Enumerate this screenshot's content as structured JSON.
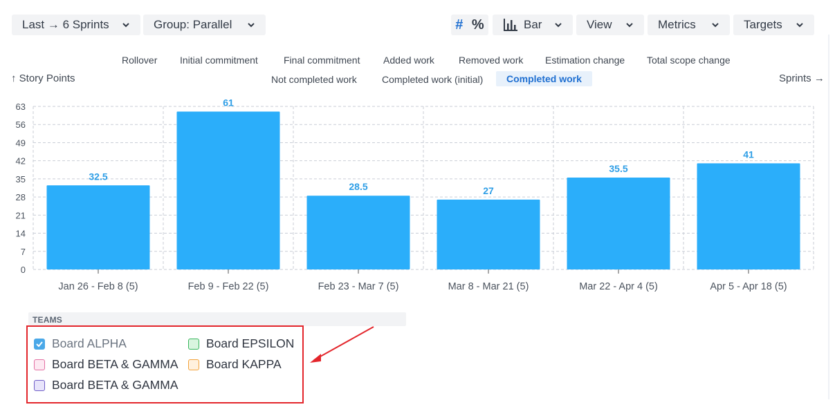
{
  "toolbar": {
    "period_label": "Last → 6 Sprints",
    "group_label": "Group: Parallel",
    "count_toggle": "#",
    "percent_toggle": "%",
    "chart_type_label": "Bar",
    "view_label": "View",
    "metrics_label": "Metrics",
    "targets_label": "Targets"
  },
  "metric_tabs_row1": [
    "Rollover",
    "Initial commitment",
    "Final commitment",
    "Added work",
    "Removed work",
    "Estimation change",
    "Total scope change"
  ],
  "metric_tabs_row2": [
    "Not completed work",
    "Completed work (initial)",
    "Completed work"
  ],
  "active_metric": "Completed work",
  "y_axis_title": "↑ Story Points",
  "x_axis_title": "Sprints →",
  "chart_data": {
    "type": "bar",
    "categories": [
      "Jan 26 - Feb 8 (5)",
      "Feb 9 - Feb 22 (5)",
      "Feb 23 - Mar 7 (5)",
      "Mar 8 - Mar 21 (5)",
      "Mar 22 - Apr 4 (5)",
      "Apr 5 - Apr 18 (5)"
    ],
    "values": [
      32.5,
      61,
      28.5,
      27,
      35.5,
      41
    ],
    "data_labels": [
      "32.5",
      "61",
      "28.5",
      "27",
      "35.5",
      "41"
    ],
    "yticks": [
      0,
      7,
      14,
      21,
      28,
      35,
      42,
      49,
      56,
      63
    ],
    "ylim": [
      0,
      63
    ],
    "grid": true,
    "bar_color": "#2baefa",
    "label_color": "#2e9ee6"
  },
  "teams": {
    "header": "TEAMS",
    "items": [
      {
        "label": "Board ALPHA",
        "checked": true,
        "color": "#4aa8e8",
        "fill": "#4aa8e8"
      },
      {
        "label": "Board EPSILON",
        "checked": false,
        "color": "#37b55c",
        "fill": "#d9f5df"
      },
      {
        "label": "Board BETA & GAMMA",
        "checked": false,
        "color": "#e36fa3",
        "fill": "#fde9f2"
      },
      {
        "label": "Board KAPPA",
        "checked": false,
        "color": "#f2a23b",
        "fill": "#fff1de"
      },
      {
        "label": "Board BETA & GAMMA",
        "checked": false,
        "color": "#6e5cc7",
        "fill": "#e8e4fb"
      }
    ]
  },
  "colors": {
    "annotation_red": "#e3252b",
    "active_tab_bg": "#e8f1fb",
    "active_tab_text": "#1f6fd1",
    "toggle_blue": "#1f6fd1"
  }
}
